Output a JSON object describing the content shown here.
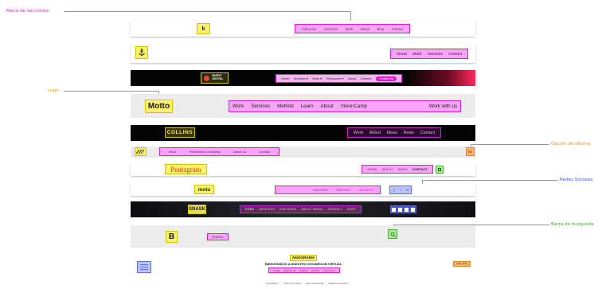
{
  "annotations": {
    "menu": "Menú de secciones",
    "logo": "Logo",
    "language": "Opción de idioma",
    "social": "Redes Sociales",
    "search": "Barra de búsqueda"
  },
  "colors": {
    "menu_label": "#d21fd0",
    "logo_label": "#e2a400",
    "language_label": "#f08a1c",
    "social_label": "#3d55d6",
    "search_label": "#3fae2c"
  },
  "row1": {
    "logo": "k",
    "menu": [
      "Coleccion",
      "Servicios",
      "Work",
      "Nosot",
      "Blog",
      "Contact"
    ]
  },
  "row2": {
    "logo_icon": "anchor-icon",
    "menu": [
      "About",
      "Work",
      "Services",
      "Contact"
    ]
  },
  "row3": {
    "logo": "BURST\nDIGITAL",
    "menu": [
      "Home",
      "Services ▾",
      "Work ▾",
      "Resources ▾",
      "About",
      "Careers"
    ],
    "cta": "Contact Us"
  },
  "row4": {
    "logo": "Motto",
    "menu": [
      "Work",
      "Services",
      "Method",
      "Learn",
      "About",
      "VisionCamp"
    ],
    "cta": "Work with us"
  },
  "row5": {
    "logo": "COLLINS",
    "menu": [
      "Work",
      "About",
      "Ideas",
      "News",
      "Contact"
    ]
  },
  "row6": {
    "logo_icon": "stripes-logo-icon",
    "menu": [
      "Work",
      "Publications & Awards",
      "About us",
      "Contact"
    ],
    "lang": "EN"
  },
  "row7": {
    "logo": "Pentagram",
    "menu": [
      "WORK",
      "ABOUT",
      "NEWS",
      "CONTACT"
    ]
  },
  "row8": {
    "logo": "motu",
    "menu": [
      "NOSOTROS",
      "PORTFOLIO",
      "LENGUAJES"
    ],
    "social": [
      "instagram-icon",
      "facebook-icon",
      "linkedin-icon"
    ]
  },
  "row9": {
    "logo": "SNASK",
    "menu": [
      "HOME",
      "SERVICES",
      "OUR WORK",
      "ABOUT SNASK",
      "CONTACT",
      "SHOP"
    ],
    "social": [
      "facebook-icon",
      "twitter-icon",
      "vimeo-icon",
      "instagram-icon"
    ]
  },
  "row10": {
    "logo": "B",
    "menu": "☰ MENU"
  },
  "row11": {
    "logo": "ANAGRAMA",
    "heading": "BIENVENIDOS A NUESTRO SHOWROOM VIRTUAL",
    "menu": [
      "HOME",
      "ARTÍCULOS",
      "DISEÑO",
      "OTROS",
      "CONTACTO"
    ],
    "lang": "ESP · ENG",
    "footer": [
      "PANADERIA",
      "ARQUITECTURA",
      "RESTAURANTES",
      "DISEÑO ENTORNO"
    ]
  }
}
